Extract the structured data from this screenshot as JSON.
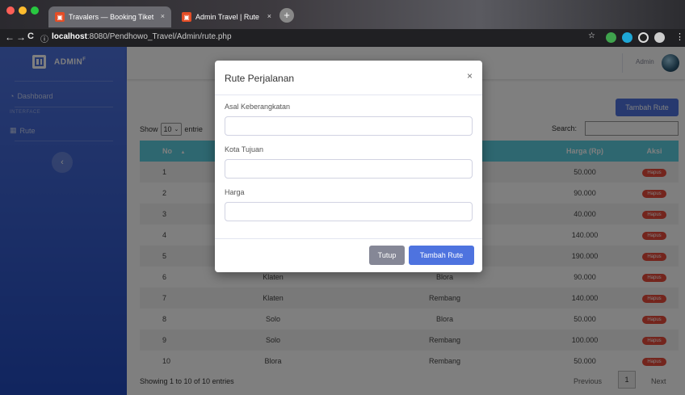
{
  "browser": {
    "tabs": [
      {
        "label": "Travalers — Booking Tiket",
        "close": "×"
      },
      {
        "label": "Admin Travel | Rute",
        "close": "×"
      }
    ],
    "new_tab": "+",
    "url_host": "localhost",
    "url_rest": ":8080/Pendhowo_Travel/Admin/rute.php",
    "info_glyph": "ⓘ",
    "back": "←",
    "forward": "→",
    "reload": "C"
  },
  "sidebar": {
    "brand": "ADMIN",
    "brand_sup": "F",
    "items": [
      {
        "label": "Dashboard",
        "glyph": "◔"
      },
      {
        "label": "Rute",
        "glyph": "▦"
      }
    ],
    "heading": "INTERFACE",
    "toggle": "‹"
  },
  "topbar": {
    "user": "Admin"
  },
  "content": {
    "add_button": "Tambah Rute",
    "show_label": "Show",
    "show_value": "10",
    "entries_label": "entrie",
    "search_label": "Search:"
  },
  "table": {
    "headers": [
      "No",
      "",
      "",
      "Harga (Rp)",
      "Aksi"
    ],
    "sort_glyph": "▲",
    "rows": [
      {
        "no": "1",
        "asal": "",
        "tujuan": "",
        "harga": "50.000",
        "aksi": "Hapus"
      },
      {
        "no": "2",
        "asal": "",
        "tujuan": "",
        "harga": "90.000",
        "aksi": "Hapus"
      },
      {
        "no": "3",
        "asal": "",
        "tujuan": "",
        "harga": "40.000",
        "aksi": "Hapus"
      },
      {
        "no": "4",
        "asal": "",
        "tujuan": "",
        "harga": "140.000",
        "aksi": "Hapus"
      },
      {
        "no": "5",
        "asal": "",
        "tujuan": "",
        "harga": "190.000",
        "aksi": "Hapus"
      },
      {
        "no": "6",
        "asal": "Klaten",
        "tujuan": "Blora",
        "harga": "90.000",
        "aksi": "Hapus"
      },
      {
        "no": "7",
        "asal": "Klaten",
        "tujuan": "Rembang",
        "harga": "140.000",
        "aksi": "Hapus"
      },
      {
        "no": "8",
        "asal": "Solo",
        "tujuan": "Blora",
        "harga": "50.000",
        "aksi": "Hapus"
      },
      {
        "no": "9",
        "asal": "Solo",
        "tujuan": "Rembang",
        "harga": "100.000",
        "aksi": "Hapus"
      },
      {
        "no": "10",
        "asal": "Blora",
        "tujuan": "Rembang",
        "harga": "50.000",
        "aksi": "Hapus"
      }
    ]
  },
  "footer": {
    "info": "Showing 1 to 10 of 10 entries",
    "previous": "Previous",
    "page": "1",
    "next": "Next"
  },
  "modal": {
    "title": "Rute Perjalanan",
    "close": "×",
    "fields": [
      {
        "label": "Asal Keberangkatan",
        "value": ""
      },
      {
        "label": "Kota Tujuan",
        "value": ""
      },
      {
        "label": "Harga",
        "value": ""
      }
    ],
    "cancel": "Tutup",
    "submit": "Tambah Rute"
  },
  "colors": {
    "primary": "#4e73df",
    "danger": "#e74a3b",
    "secondary": "#858796",
    "table_head": "#5dcfe0"
  }
}
